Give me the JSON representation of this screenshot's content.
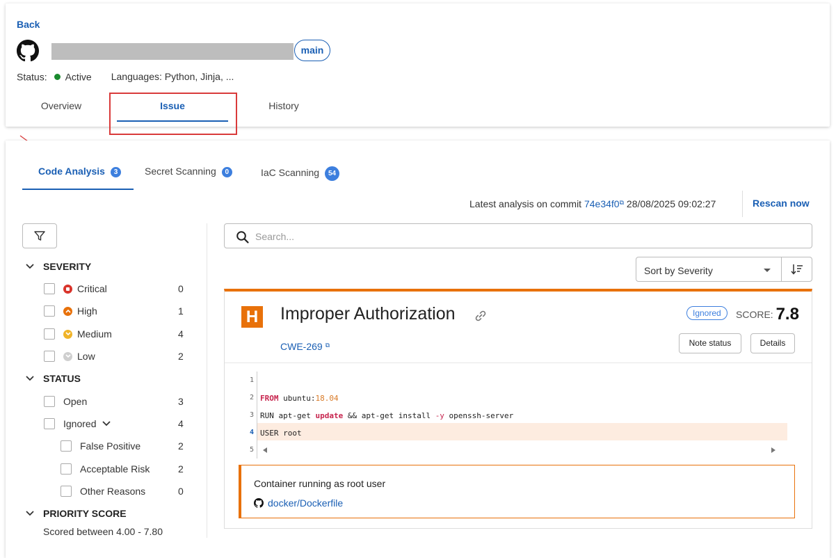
{
  "header": {
    "back_label": "Back",
    "branch": "main",
    "status_label": "Status:",
    "status_value": "Active",
    "languages": "Languages: Python, Jinja, ...",
    "tabs": [
      {
        "label": "Overview"
      },
      {
        "label": "Issue"
      },
      {
        "label": "History"
      }
    ]
  },
  "subtabs": [
    {
      "label": "Code Analysis",
      "count": "3"
    },
    {
      "label": "Secret Scanning",
      "count": "0"
    },
    {
      "label": "IaC Scanning",
      "count": "54"
    }
  ],
  "analysis": {
    "prefix": "Latest analysis on commit",
    "commit": "74e34f0",
    "datetime": "28/08/2025 09:02:27",
    "rescan_label": "Rescan now"
  },
  "filters": {
    "severity": {
      "title": "SEVERITY",
      "items": [
        {
          "label": "Critical",
          "count": "0",
          "color": "#d9342b"
        },
        {
          "label": "High",
          "count": "1",
          "color": "#e8710a"
        },
        {
          "label": "Medium",
          "count": "4",
          "color": "#f0b429"
        },
        {
          "label": "Low",
          "count": "2",
          "color": "#c8c8c8"
        }
      ]
    },
    "status": {
      "title": "STATUS",
      "open": {
        "label": "Open",
        "count": "3"
      },
      "ignored": {
        "label": "Ignored",
        "count": "4"
      },
      "sub": [
        {
          "label": "False Positive",
          "count": "2"
        },
        {
          "label": "Acceptable Risk",
          "count": "2"
        },
        {
          "label": "Other Reasons",
          "count": "0"
        }
      ]
    },
    "priority": {
      "title": "PRIORITY SCORE",
      "range": "Scored between 4.00 - 7.80"
    }
  },
  "search": {
    "placeholder": "Search..."
  },
  "sort": {
    "label": "Sort by Severity"
  },
  "issue": {
    "severity_letter": "H",
    "title": "Improper Authorization",
    "cwe": "CWE-269",
    "status_badge": "Ignored",
    "score_label": "SCORE:",
    "score": "7.8",
    "note_button": "Note status",
    "details_button": "Details",
    "code": {
      "line_numbers": [
        "1",
        "2",
        "3",
        "4",
        "5"
      ],
      "line2_kw": "FROM",
      "line2_text": " ubuntu:",
      "line2_num": "18.04",
      "line3_a": "RUN apt-get ",
      "line3_kw1": "update",
      "line3_b": " && apt-get install ",
      "line3_kw2": "-y",
      "line3_c": " openssh-server",
      "line4": "USER root"
    },
    "message": "Container running as root user",
    "file": "docker/Dockerfile"
  }
}
